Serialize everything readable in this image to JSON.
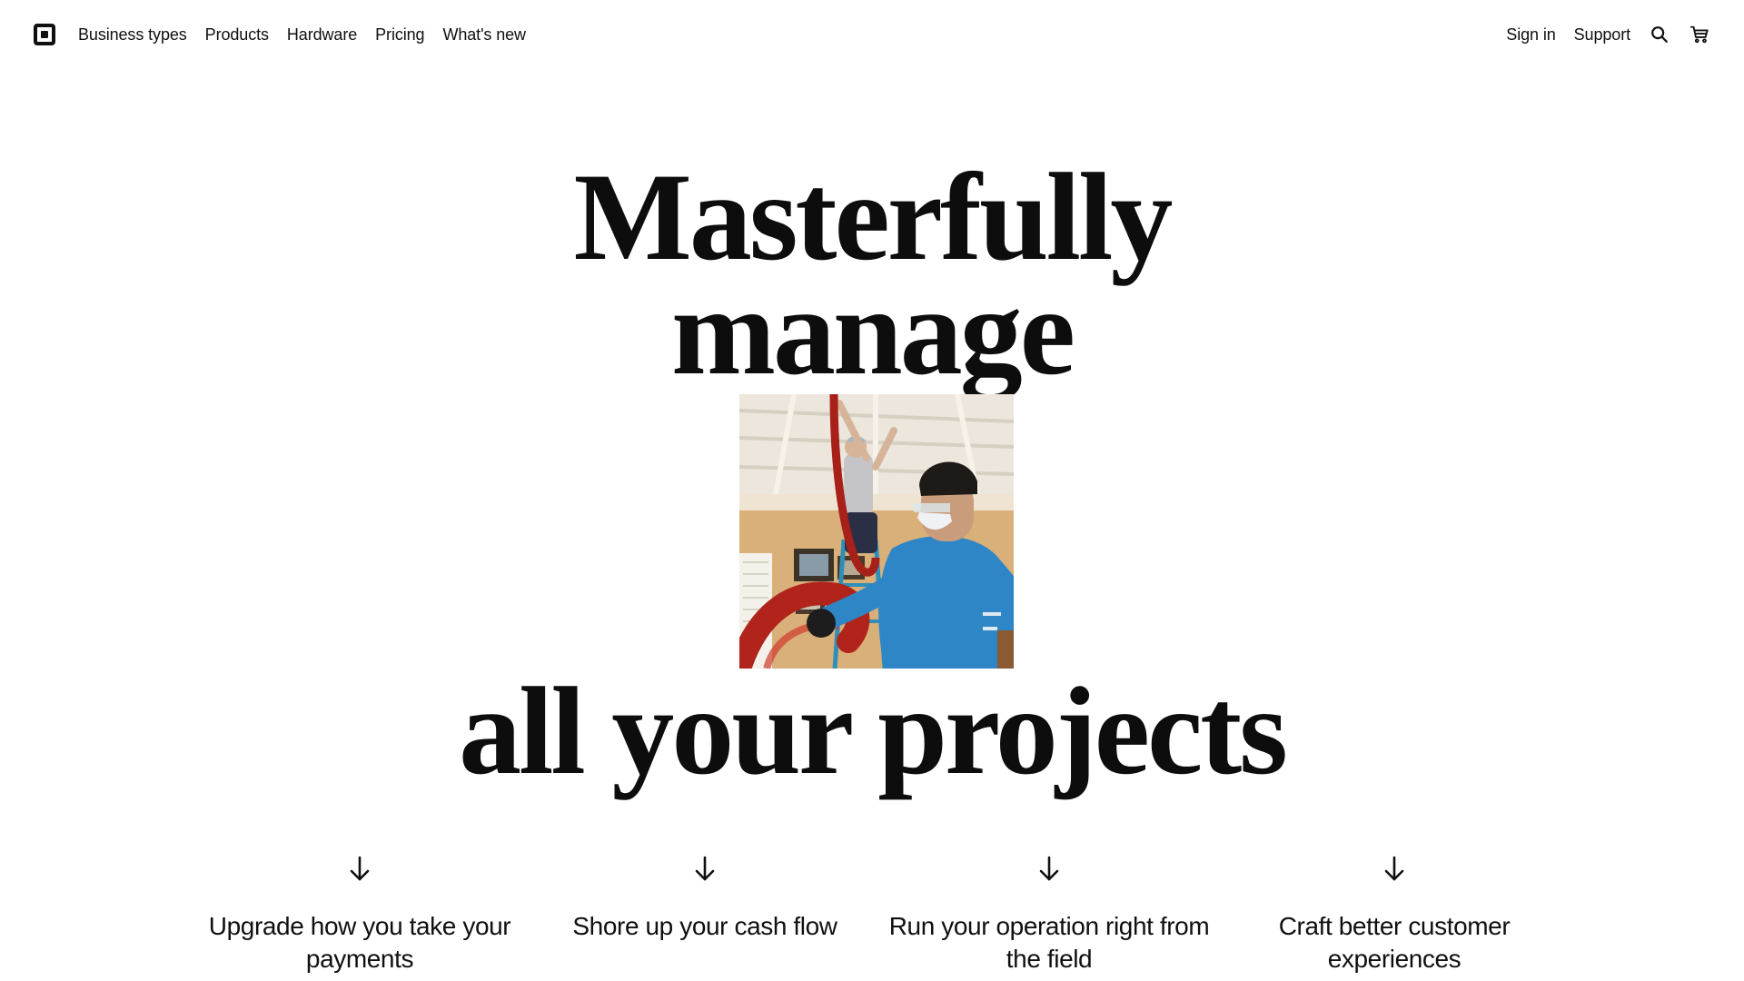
{
  "nav": {
    "logo_icon": "square-logo-icon",
    "links": [
      "Business types",
      "Products",
      "Hardware",
      "Pricing",
      "What's new"
    ],
    "sign_in": "Sign in",
    "support": "Support",
    "search_icon": "search-icon",
    "cart_icon": "cart-icon"
  },
  "hero": {
    "line1": "Masterfully",
    "line2": "manage",
    "line3": "all your projects"
  },
  "features": [
    {
      "label": "Upgrade how you take your payments",
      "icon": "arrow-down-icon"
    },
    {
      "label": "Shore up your cash flow",
      "icon": "arrow-down-icon"
    },
    {
      "label": "Run your operation right from the field",
      "icon": "arrow-down-icon"
    },
    {
      "label": "Craft better customer experiences",
      "icon": "arrow-down-icon"
    }
  ],
  "colors": {
    "text": "#101010",
    "background": "#ffffff"
  }
}
